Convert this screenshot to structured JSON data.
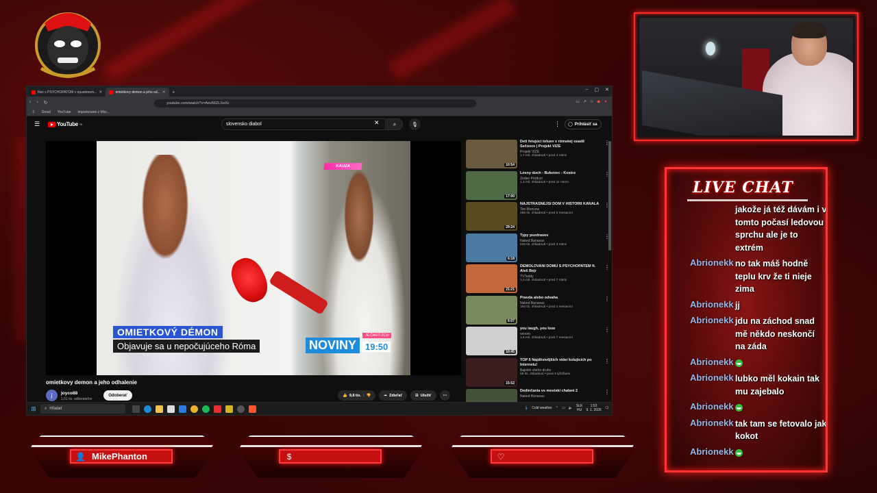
{
  "browser": {
    "tabs": [
      {
        "label": "Noc s PSYCHOPATOM v opustenom...",
        "active": false
      },
      {
        "label": "omietkovy demon a jeho od...",
        "active": true
      }
    ],
    "url": "youtube.com/watch?v=Aev66ZLXeXc",
    "bookmarks": [
      "Gmail",
      "YouTube",
      "Importované z Micr..."
    ]
  },
  "youtube": {
    "logo_text": "YouTube",
    "logo_country": "SK",
    "search_query": "slovensko diabol",
    "signin_label": "Prihlásiť sa",
    "video": {
      "overlay_tag": "KAUZA",
      "lower_third_title": "OMIETKOVÝ DÉMON",
      "lower_third_subtitle": "Objavuje sa u nepočujúceho Róma",
      "news_brand": "NOVINY",
      "news_time": "19:50",
      "news_date": "JE ČASTÍ 2010"
    },
    "title": "omietkovy demon a jeho odhalenie",
    "channel": {
      "avatar_letter": "j",
      "name": "joyco88",
      "subscribers": "1,01 tis. odberateľov"
    },
    "subscribe_label": "Odoberať",
    "actions": {
      "likes": "9,8 tis.",
      "share": "Zdieľať",
      "save": "Uložiť"
    },
    "recommendations": [
      {
        "title": "Deti fetujúci toluen v rómskej osadě Sečovce | Projekt VIZE",
        "channel": "Projekt VIZE",
        "meta": "1,7 mil. zhliadnutí • pred 4 rokmi",
        "duration": "10:54",
        "thumb_color": "#6b5a3e"
      },
      {
        "title": "Lesny duch - Bukovec - Kosice",
        "channel": "Zeden Product",
        "meta": "1,3 mil. zhliadnutí • pred 11 rokmi",
        "duration": "17:00",
        "thumb_color": "#4f6b45"
      },
      {
        "title": "NAJSTRAŠNEJŠÍ DOM V HISTÓRII KANÁLA",
        "channel": "Tim Monsow",
        "meta": "286 tis. zhliadnutí • pred 6 mesiacmi",
        "duration": "29:24",
        "thumb_color": "#5a4a20"
      },
      {
        "title": "Typy pozdravov",
        "channel": "Naked Bananas",
        "meta": "528 tis. zhliadnutí • pred 4 rokmi",
        "duration": "6:18",
        "thumb_color": "#4d7aa3"
      },
      {
        "title": "DEMOLOVANÍ DOMU S PSYCHOPATEM ft. Aleš Bejr",
        "channel": "TVTeddy",
        "meta": "3,3 mil. zhliadnutí • pred 7 rokmi",
        "duration": "21:21",
        "thumb_color": "#c2683a"
      },
      {
        "title": "Pravda alebo odvaha",
        "channel": "Naked Bananas",
        "meta": "183 tis. zhliadnutí • pred 4 mesiacmi",
        "duration": "6:07",
        "thumb_color": "#7a8a5c"
      },
      {
        "title": "you laugh, you lose",
        "channel": "venom",
        "meta": "1,6 mil. zhliadnutí • pred 7 mesiacmi",
        "duration": "10:45",
        "thumb_color": "#cfcfcf"
      },
      {
        "title": "TOP 5 Najděsivějších videí kolujících po Internetu!",
        "channel": "Bajstek všeho druhu",
        "meta": "58 tis. zhliadnutí • pred 3 týždňami",
        "duration": "15:52",
        "thumb_color": "#3a1d1d"
      },
      {
        "title": "Dedinčania vs mestskí chalani 2",
        "channel": "Naked Bananas",
        "meta": "",
        "duration": "",
        "thumb_color": "#44503a"
      }
    ]
  },
  "taskbar": {
    "search_placeholder": "Hľadať",
    "weather": "Cold weather",
    "language": "SLK",
    "language_sub": "HU",
    "time": "1:53",
    "date": "9. 1. 2026"
  },
  "chat": {
    "title": "LIVE CHAT",
    "messages": [
      {
        "user": "",
        "text": "jakože já též dávám i v tomto počasí ledovou sprchu ale je to extrém",
        "emote": false
      },
      {
        "user": "Abrionekk",
        "text": "no tak máš hodně teplu krv že ti nieje zima",
        "emote": false
      },
      {
        "user": "Abrionekk",
        "text": "jj",
        "emote": false
      },
      {
        "user": "Abrionekk",
        "text": "jdu na záchod snad mě někdo neskončí na záda",
        "emote": false
      },
      {
        "user": "Abrionekk",
        "text": "",
        "emote": true
      },
      {
        "user": "Abrionekk",
        "text": "lubko měl kokain tak mu zajebalo",
        "emote": false
      },
      {
        "user": "Abrionekk",
        "text": "",
        "emote": true
      },
      {
        "user": "Abrionekk",
        "text": "tak tam se fetovalo jak kokot",
        "emote": false
      },
      {
        "user": "Abrionekk",
        "text": "",
        "emote": true
      }
    ]
  },
  "banners": [
    {
      "icon": "user-icon",
      "label": "MikePhanton"
    },
    {
      "icon": "dollar-icon",
      "label": ""
    },
    {
      "icon": "heart-icon",
      "label": ""
    }
  ],
  "colors": {
    "accent": "#ff2a2a",
    "youtube_red": "#ff0000",
    "chat_user": "#9ab6e6"
  }
}
